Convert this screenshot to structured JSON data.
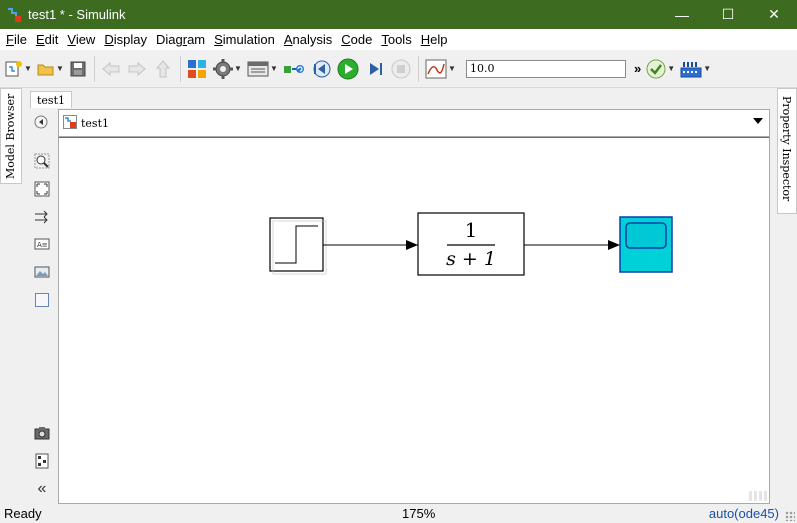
{
  "window": {
    "title": "test1 * - Simulink",
    "controls": {
      "minimize": "—",
      "maximize": "☐",
      "close": "✕"
    }
  },
  "menu": {
    "items": [
      {
        "label": "File",
        "mnemonic": "F",
        "rest": "ile"
      },
      {
        "label": "Edit",
        "mnemonic": "E",
        "rest": "dit"
      },
      {
        "label": "View",
        "mnemonic": "V",
        "rest": "iew"
      },
      {
        "label": "Display",
        "mnemonic": "D",
        "rest": "isplay"
      },
      {
        "label": "Diagram",
        "pre": "Diag",
        "mnemonic": "r",
        "rest": "am"
      },
      {
        "label": "Simulation",
        "mnemonic": "S",
        "rest": "imulation"
      },
      {
        "label": "Analysis",
        "mnemonic": "A",
        "rest": "nalysis"
      },
      {
        "label": "Code",
        "mnemonic": "C",
        "rest": "ode"
      },
      {
        "label": "Tools",
        "mnemonic": "T",
        "rest": "ools"
      },
      {
        "label": "Help",
        "mnemonic": "H",
        "rest": "elp"
      }
    ]
  },
  "toolbar": {
    "stop_time": "10.0",
    "overflow": "»"
  },
  "side_tabs": {
    "left": "Model Browser",
    "right": "Property Inspector"
  },
  "document": {
    "tab": "test1",
    "breadcrumb": "test1"
  },
  "palette": {
    "collapse": "«"
  },
  "diagram": {
    "blocks": [
      {
        "kind": "step"
      },
      {
        "kind": "transfer-fcn",
        "numerator": "1",
        "denominator": "s + 1"
      },
      {
        "kind": "scope"
      }
    ],
    "colors": {
      "scope_fill": "#00d0d8",
      "scope_border": "#0a3fa8"
    }
  },
  "status": {
    "state": "Ready",
    "zoom": "175%",
    "solver": "auto(ode45)"
  },
  "colors": {
    "titlebar": "#3d6b1f",
    "run_button": "#2cae2c"
  }
}
